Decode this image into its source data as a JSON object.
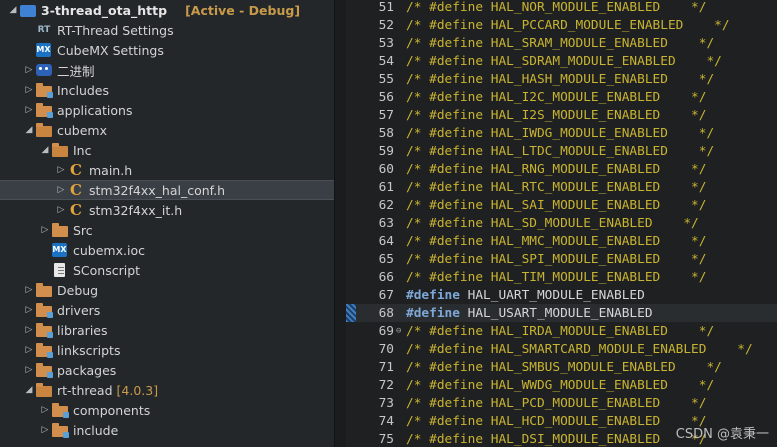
{
  "tree": {
    "items": [
      {
        "label": "3-thread_ota_http",
        "tag": "[Active - Debug]",
        "arrow": "◢",
        "icon": "project-icon",
        "indent": 0
      },
      {
        "label": "RT-Thread Settings",
        "arrow": "",
        "icon": "rt-thread-settings-icon",
        "indent": 1
      },
      {
        "label": "CubeMX Settings",
        "arrow": "",
        "icon": "cubemx-icon",
        "indent": 1
      },
      {
        "label": "二进制",
        "arrow": "▷",
        "icon": "binaries-icon",
        "indent": 1
      },
      {
        "label": "Includes",
        "arrow": "▷",
        "icon": "includes-folder-icon",
        "indent": 1
      },
      {
        "label": "applications",
        "arrow": "▷",
        "icon": "source-folder-icon",
        "indent": 1
      },
      {
        "label": "cubemx",
        "arrow": "◢",
        "icon": "folder-open-icon",
        "indent": 1
      },
      {
        "label": "Inc",
        "arrow": "◢",
        "icon": "folder-open-icon",
        "indent": 2
      },
      {
        "label": "main.h",
        "arrow": "▷",
        "icon": "c-header-file-icon",
        "indent": 3
      },
      {
        "label": "stm32f4xx_hal_conf.h",
        "arrow": "▷",
        "icon": "c-header-file-icon",
        "indent": 3,
        "selected": true
      },
      {
        "label": "stm32f4xx_it.h",
        "arrow": "▷",
        "icon": "c-header-file-icon",
        "indent": 3
      },
      {
        "label": "Src",
        "arrow": "▷",
        "icon": "folder-icon",
        "indent": 2
      },
      {
        "label": "cubemx.ioc",
        "arrow": "",
        "icon": "cubemx-file-icon",
        "indent": 2
      },
      {
        "label": "SConscript",
        "arrow": "",
        "icon": "text-file-icon",
        "indent": 2
      },
      {
        "label": "Debug",
        "arrow": "▷",
        "icon": "folder-icon",
        "indent": 1
      },
      {
        "label": "drivers",
        "arrow": "▷",
        "icon": "source-folder-icon",
        "indent": 1
      },
      {
        "label": "libraries",
        "arrow": "▷",
        "icon": "source-folder-icon",
        "indent": 1
      },
      {
        "label": "linkscripts",
        "arrow": "▷",
        "icon": "source-folder-icon",
        "indent": 1
      },
      {
        "label": "packages",
        "arrow": "▷",
        "icon": "source-folder-icon",
        "indent": 1
      },
      {
        "label": "rt-thread",
        "version": "[4.0.3]",
        "arrow": "◢",
        "icon": "folder-open-icon",
        "indent": 1
      },
      {
        "label": "components",
        "arrow": "▷",
        "icon": "source-folder-icon",
        "indent": 2
      },
      {
        "label": "include",
        "arrow": "▷",
        "icon": "source-folder-icon",
        "indent": 2
      }
    ]
  },
  "editor": {
    "lines": [
      {
        "num": "51",
        "text": "/* #define HAL_NOR_MODULE_ENABLED    */",
        "kind": "comment"
      },
      {
        "num": "52",
        "text": "/* #define HAL_PCCARD_MODULE_ENABLED    */",
        "kind": "comment"
      },
      {
        "num": "53",
        "text": "/* #define HAL_SRAM_MODULE_ENABLED    */",
        "kind": "comment"
      },
      {
        "num": "54",
        "text": "/* #define HAL_SDRAM_MODULE_ENABLED    */",
        "kind": "comment"
      },
      {
        "num": "55",
        "text": "/* #define HAL_HASH_MODULE_ENABLED    */",
        "kind": "comment"
      },
      {
        "num": "56",
        "text": "/* #define HAL_I2C_MODULE_ENABLED    */",
        "kind": "comment"
      },
      {
        "num": "57",
        "text": "/* #define HAL_I2S_MODULE_ENABLED    */",
        "kind": "comment"
      },
      {
        "num": "58",
        "text": "/* #define HAL_IWDG_MODULE_ENABLED    */",
        "kind": "comment"
      },
      {
        "num": "59",
        "text": "/* #define HAL_LTDC_MODULE_ENABLED    */",
        "kind": "comment"
      },
      {
        "num": "60",
        "text": "/* #define HAL_RNG_MODULE_ENABLED    */",
        "kind": "comment"
      },
      {
        "num": "61",
        "text": "/* #define HAL_RTC_MODULE_ENABLED    */",
        "kind": "comment"
      },
      {
        "num": "62",
        "text": "/* #define HAL_SAI_MODULE_ENABLED    */",
        "kind": "comment"
      },
      {
        "num": "63",
        "text": "/* #define HAL_SD_MODULE_ENABLED    */",
        "kind": "comment"
      },
      {
        "num": "64",
        "text": "/* #define HAL_MMC_MODULE_ENABLED    */",
        "kind": "comment"
      },
      {
        "num": "65",
        "text": "/* #define HAL_SPI_MODULE_ENABLED    */",
        "kind": "comment"
      },
      {
        "num": "66",
        "text": "/* #define HAL_TIM_MODULE_ENABLED    */",
        "kind": "comment"
      },
      {
        "num": "67",
        "keyword": "#define",
        "text": " HAL_UART_MODULE_ENABLED",
        "kind": "define"
      },
      {
        "num": "68",
        "keyword": "#define",
        "text": " HAL_USART_MODULE_ENABLED",
        "kind": "define",
        "current": true,
        "marker": true
      },
      {
        "num": "69",
        "text": "/* #define HAL_IRDA_MODULE_ENABLED    */",
        "kind": "comment",
        "fold": "⊖"
      },
      {
        "num": "70",
        "text": "/* #define HAL_SMARTCARD_MODULE_ENABLED    */",
        "kind": "comment"
      },
      {
        "num": "71",
        "text": "/* #define HAL_SMBUS_MODULE_ENABLED    */",
        "kind": "comment"
      },
      {
        "num": "72",
        "text": "/* #define HAL_WWDG_MODULE_ENABLED    */",
        "kind": "comment"
      },
      {
        "num": "73",
        "text": "/* #define HAL_PCD_MODULE_ENABLED    */",
        "kind": "comment"
      },
      {
        "num": "74",
        "text": "/* #define HAL_HCD_MODULE_ENABLED    */",
        "kind": "comment"
      },
      {
        "num": "75",
        "text": "/* #define HAL_DSI_MODULE_ENABLED    */",
        "kind": "comment"
      }
    ]
  },
  "watermark": "CSDN @袁秉一"
}
